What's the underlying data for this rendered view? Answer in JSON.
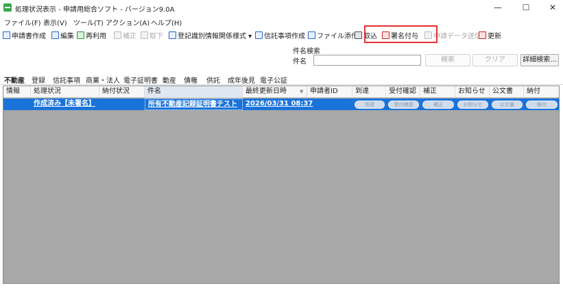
{
  "window": {
    "title": "処理状況表示 - 申請用総合ソフト - バージョン9.0A",
    "minimize_label": "—",
    "maximize_label": "☐",
    "close_label": "✕"
  },
  "menu": {
    "items": [
      "ファイル(F)",
      "表示(V)",
      "ツール(T)",
      "アクション(A)",
      "ヘルプ(H)"
    ]
  },
  "toolbar": {
    "buttons": [
      "申請書作成",
      "編集",
      "再利用",
      "補正",
      "取下",
      "登記識別情報関係様式 ▾",
      "信託事項作成",
      "ファイル添付",
      "取込",
      "署名付与",
      "申請データ送信",
      "更新"
    ]
  },
  "search": {
    "group_label": "件名検索",
    "field_label": "件名",
    "value": "",
    "search_button": "検索",
    "clear_button": "クリア",
    "detail_button": "詳細検索..."
  },
  "tabs": [
    "不動産",
    "登録",
    "信託事項",
    "商業・法人",
    "電子証明書",
    "動産",
    "債権",
    "供託",
    "成年後見",
    "電子公証"
  ],
  "grid": {
    "columns": [
      "情報",
      "処理状況",
      "納付状況",
      "件名",
      "最終更新日時",
      "申請者ID",
      "到達",
      "受付確認",
      "補正",
      "お知らせ",
      "公文書",
      "納付"
    ],
    "row": {
      "info": "",
      "status": "作成済み【未署名】",
      "payment_status": "",
      "subject": "所有不動産記録証明書テスト",
      "updated": "2026/03/31 08:37",
      "applicant_id": "",
      "buttons": [
        "到達",
        "受付確認",
        "補正",
        "お知らせ",
        "公文書",
        "納付"
      ]
    }
  }
}
